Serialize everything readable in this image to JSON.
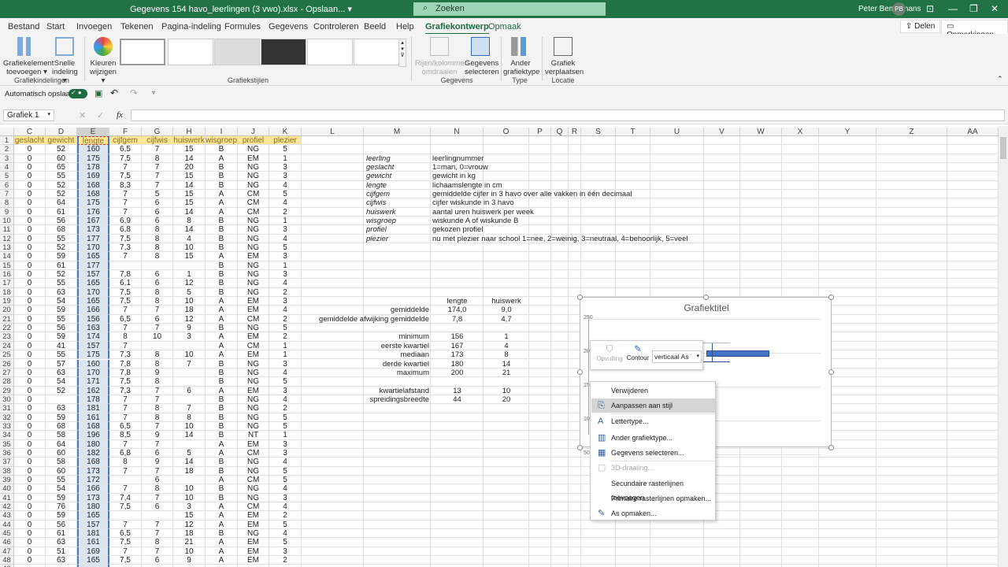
{
  "titlebar": {
    "filename": "Gegevens 154 havo_leerlingen (3 vwo).xlsx  -  Opslaan...  ▾",
    "search": "Zoeken",
    "user": "Peter Bemelmans",
    "initials": "PB"
  },
  "menu": [
    "Bestand",
    "Start",
    "Invoegen",
    "Tekenen",
    "Pagina-indeling",
    "Formules",
    "Gegevens",
    "Controleren",
    "Beeld",
    "Help",
    "Grafiekontwerp",
    "Opmaak"
  ],
  "share": {
    "delen": "Delen",
    "opmerkingen": "Opmerkingen"
  },
  "ribbon": {
    "add_element": [
      "Grafiekelement",
      "toevoegen ▾"
    ],
    "quick_layout": [
      "Snelle",
      "indeling ▾"
    ],
    "group_layouts": "Grafiekindelingen",
    "colors": [
      "Kleuren",
      "wijzigen ▾"
    ],
    "group_styles": "Grafiekstijlen",
    "switch": [
      "Rijen/kolommen",
      "omdraaien"
    ],
    "select_data": [
      "Gegevens",
      "selecteren"
    ],
    "group_data": "Gegevens",
    "change_type": [
      "Ander",
      "grafiektype"
    ],
    "group_type": "Type",
    "move": [
      "Grafiek",
      "verplaatsen"
    ],
    "group_location": "Locatie"
  },
  "qat": {
    "autosave": "Automatisch opslaan"
  },
  "formula": {
    "namebox": "Grafiek 1",
    "fx": "fx"
  },
  "columns": [
    "C",
    "D",
    "E",
    "F",
    "G",
    "H",
    "I",
    "J",
    "K",
    "L",
    "M",
    "N",
    "O",
    "P",
    "Q",
    "R",
    "S",
    "T",
    "U",
    "V",
    "W",
    "X",
    "Y",
    "Z",
    "AA"
  ],
  "headers": [
    "geslacht",
    "gewicht",
    "lengte",
    "cijfgem",
    "cijfwis",
    "huiswerk",
    "wisgroep",
    "profiel",
    "plezier"
  ],
  "rows": [
    [
      "0",
      "52",
      "160",
      "6,5",
      "7",
      "15",
      "B",
      "NG",
      "5"
    ],
    [
      "0",
      "60",
      "175",
      "7,5",
      "8",
      "14",
      "A",
      "EM",
      "1"
    ],
    [
      "0",
      "65",
      "178",
      "7",
      "7",
      "20",
      "B",
      "NG",
      "3"
    ],
    [
      "0",
      "55",
      "169",
      "7,5",
      "7",
      "15",
      "B",
      "NG",
      "3"
    ],
    [
      "0",
      "52",
      "168",
      "8,3",
      "7",
      "14",
      "B",
      "NG",
      "4"
    ],
    [
      "0",
      "52",
      "168",
      "7",
      "5",
      "15",
      "A",
      "CM",
      "5"
    ],
    [
      "0",
      "64",
      "175",
      "7",
      "6",
      "15",
      "A",
      "CM",
      "4"
    ],
    [
      "0",
      "61",
      "176",
      "7",
      "6",
      "14",
      "A",
      "CM",
      "2"
    ],
    [
      "0",
      "56",
      "167",
      "6,9",
      "6",
      "8",
      "B",
      "NG",
      "1"
    ],
    [
      "0",
      "68",
      "173",
      "6,8",
      "8",
      "14",
      "B",
      "NG",
      "3"
    ],
    [
      "0",
      "55",
      "177",
      "7,5",
      "8",
      "4",
      "B",
      "NG",
      "4"
    ],
    [
      "0",
      "52",
      "170",
      "7,3",
      "8",
      "10",
      "B",
      "NG",
      "5"
    ],
    [
      "0",
      "59",
      "165",
      "7",
      "8",
      "15",
      "A",
      "EM",
      "3"
    ],
    [
      "0",
      "61",
      "177",
      "",
      "",
      "",
      "B",
      "NG",
      "1"
    ],
    [
      "0",
      "52",
      "157",
      "7,8",
      "6",
      "1",
      "B",
      "NG",
      "3"
    ],
    [
      "0",
      "55",
      "165",
      "6,1",
      "6",
      "12",
      "B",
      "NG",
      "4"
    ],
    [
      "0",
      "63",
      "170",
      "7,5",
      "8",
      "5",
      "B",
      "NG",
      "2"
    ],
    [
      "0",
      "54",
      "165",
      "7,5",
      "8",
      "10",
      "A",
      "EM",
      "3"
    ],
    [
      "0",
      "59",
      "166",
      "7",
      "7",
      "18",
      "A",
      "EM",
      "4"
    ],
    [
      "0",
      "55",
      "156",
      "6,5",
      "6",
      "12",
      "A",
      "CM",
      "2"
    ],
    [
      "0",
      "56",
      "163",
      "7",
      "7",
      "9",
      "B",
      "NG",
      "5"
    ],
    [
      "0",
      "59",
      "174",
      "8",
      "10",
      "3",
      "A",
      "EM",
      "2"
    ],
    [
      "0",
      "41",
      "157",
      "7",
      "",
      "",
      "A",
      "CM",
      "1"
    ],
    [
      "0",
      "55",
      "175",
      "7,3",
      "8",
      "10",
      "A",
      "EM",
      "1"
    ],
    [
      "0",
      "57",
      "160",
      "7,8",
      "8",
      "7",
      "B",
      "NG",
      "3"
    ],
    [
      "0",
      "63",
      "170",
      "7,8",
      "9",
      "",
      "B",
      "NG",
      "4"
    ],
    [
      "0",
      "54",
      "171",
      "7,5",
      "8",
      "",
      "B",
      "NG",
      "5"
    ],
    [
      "0",
      "52",
      "162",
      "7,3",
      "7",
      "6",
      "A",
      "EM",
      "3"
    ],
    [
      "0",
      "",
      "178",
      "7",
      "7",
      "",
      "B",
      "NG",
      "4"
    ],
    [
      "0",
      "63",
      "181",
      "7",
      "8",
      "7",
      "B",
      "NG",
      "2"
    ],
    [
      "0",
      "59",
      "161",
      "7",
      "8",
      "8",
      "B",
      "NG",
      "5"
    ],
    [
      "0",
      "68",
      "168",
      "6,5",
      "7",
      "10",
      "B",
      "NG",
      "5"
    ],
    [
      "0",
      "58",
      "196",
      "8,5",
      "9",
      "14",
      "B",
      "NT",
      "1"
    ],
    [
      "0",
      "64",
      "180",
      "7",
      "7",
      "",
      "A",
      "EM",
      "3"
    ],
    [
      "0",
      "60",
      "182",
      "6,8",
      "6",
      "5",
      "A",
      "CM",
      "3"
    ],
    [
      "0",
      "58",
      "168",
      "8",
      "9",
      "14",
      "B",
      "NG",
      "4"
    ],
    [
      "0",
      "60",
      "173",
      "7",
      "7",
      "18",
      "B",
      "NG",
      "5"
    ],
    [
      "0",
      "55",
      "172",
      "",
      "6",
      "",
      "A",
      "CM",
      "5"
    ],
    [
      "0",
      "54",
      "166",
      "7",
      "8",
      "10",
      "B",
      "NG",
      "4"
    ],
    [
      "0",
      "59",
      "173",
      "7,4",
      "7",
      "10",
      "B",
      "NG",
      "3"
    ],
    [
      "0",
      "76",
      "180",
      "7,5",
      "6",
      "3",
      "A",
      "CM",
      "4"
    ],
    [
      "0",
      "59",
      "165",
      "",
      "",
      "15",
      "A",
      "EM",
      "2"
    ],
    [
      "0",
      "56",
      "157",
      "7",
      "7",
      "12",
      "A",
      "EM",
      "5"
    ],
    [
      "0",
      "61",
      "181",
      "6,5",
      "7",
      "18",
      "B",
      "NG",
      "4"
    ],
    [
      "0",
      "63",
      "161",
      "7,5",
      "8",
      "21",
      "A",
      "EM",
      "5"
    ],
    [
      "0",
      "51",
      "169",
      "7",
      "7",
      "10",
      "A",
      "EM",
      "3"
    ],
    [
      "0",
      "63",
      "165",
      "7,5",
      "6",
      "9",
      "A",
      "EM",
      "2"
    ]
  ],
  "legend": [
    [
      "leerling",
      "leerlingnummer"
    ],
    [
      "geslacht",
      "1=man, 0=vrouw"
    ],
    [
      "gewicht",
      "gewicht in kg"
    ],
    [
      "lengte",
      "lichaamslengte in cm"
    ],
    [
      "cijfgem",
      "gemiddelde cijfer in 3 havo over alle vakken in één decimaal"
    ],
    [
      "cijfwis",
      "cijfer wiskunde in 3 havo"
    ],
    [
      "huiswerk",
      "aantal uren huiswerk per week"
    ],
    [
      "wisgroep",
      "wiskunde A of wiskunde B"
    ],
    [
      "profiel",
      "gekozen profiel"
    ],
    [
      "plezier",
      "nu met plezier naar school 1=nee, 2=weinig, 3=neutraal, 4=behoorlijk, 5=veel"
    ]
  ],
  "stats": {
    "headers": [
      "lengte",
      "huiswerk"
    ],
    "rows": [
      {
        "row": 20,
        "label": "gemiddelde",
        "v": [
          "174,0",
          "9,0"
        ]
      },
      {
        "row": 21,
        "label": "gemiddelde afwijking gemiddelde",
        "v": [
          "7,8",
          "4,7"
        ]
      },
      {
        "row": 23,
        "label": "minimum",
        "v": [
          "156",
          "1"
        ]
      },
      {
        "row": 24,
        "label": "eerste kwartiel",
        "v": [
          "167",
          "4"
        ]
      },
      {
        "row": 25,
        "label": "mediaan",
        "v": [
          "173",
          "8"
        ]
      },
      {
        "row": 26,
        "label": "derde kwartiel",
        "v": [
          "180",
          "14"
        ]
      },
      {
        "row": 27,
        "label": "maximum",
        "v": [
          "200",
          "21"
        ]
      },
      {
        "row": 29,
        "label": "kwartielafstand",
        "v": [
          "13",
          "10"
        ]
      },
      {
        "row": 30,
        "label": "spreidingsbreedte",
        "v": [
          "44",
          "20"
        ]
      }
    ]
  },
  "chart": {
    "title": "Grafiektitel",
    "yticks": [
      "250",
      "200",
      "150",
      "100",
      "50"
    ]
  },
  "minibar": {
    "fill": "Opvulling",
    "outline": "Contour",
    "element": "verticaal As"
  },
  "context_menu": [
    {
      "label": "Verwijderen",
      "icon": ""
    },
    {
      "label": "Aanpassen aan stijl",
      "icon": "reset-style-icon",
      "hl": true
    },
    {
      "label": "Lettertype...",
      "icon": "font-icon"
    },
    {
      "label": "Ander grafiektype...",
      "icon": "chart-type-icon"
    },
    {
      "label": "Gegevens selecteren...",
      "icon": "select-data-icon"
    },
    {
      "label": "3D-draaiing...",
      "icon": "3d-rotation-icon",
      "dis": true
    },
    {
      "label": "Secundaire rasterlijnen toevoegen",
      "icon": ""
    },
    {
      "label": "Primaire rasterlijnen opmaken...",
      "icon": ""
    },
    {
      "label": "As opmaken...",
      "icon": "format-axis-icon"
    }
  ]
}
